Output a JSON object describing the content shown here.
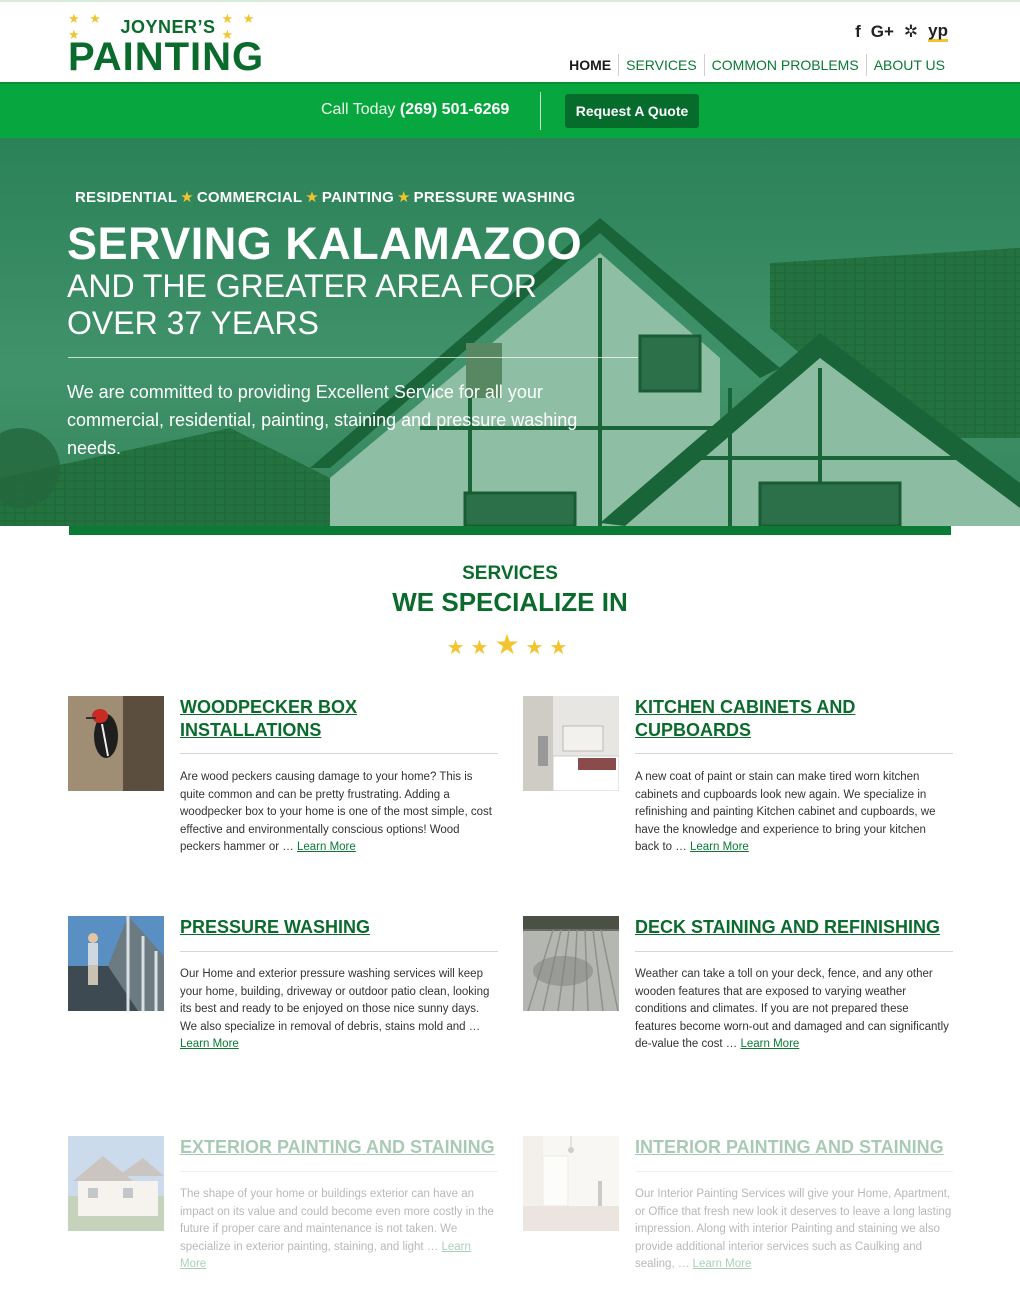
{
  "header": {
    "logo_name": "JOYNER’S",
    "logo_main": "PAINTING",
    "logo_stars": "★ ★ ★",
    "social": [
      {
        "icon": "facebook-icon",
        "label": "f"
      },
      {
        "icon": "google-plus-icon",
        "label": "G+"
      },
      {
        "icon": "yelp-icon",
        "label": "✲"
      },
      {
        "icon": "yellow-pages-icon",
        "label": "yp"
      }
    ],
    "nav": [
      "HOME",
      "SERVICES",
      "COMMON PROBLEMS",
      "ABOUT US"
    ]
  },
  "cta": {
    "call_label": "Call Today",
    "phone": "(269) 501-6269",
    "button": "Request A Quote"
  },
  "hero": {
    "tags": [
      "RESIDENTIAL",
      "COMMERCIAL",
      "PAINTING",
      "PRESSURE WASHING"
    ],
    "title": "SERVING KALAMAZOO",
    "subtitle": "AND THE GREATER AREA FOR OVER 37 YEARS",
    "description": "We are committed to providing Excellent Service for all your commercial, residential, painting, staining and pressure washing needs."
  },
  "services": {
    "kicker": "SERVICES",
    "title": "WE SPECIALIZE IN",
    "learn_more": "Learn More",
    "ellipsis": "…",
    "items": [
      {
        "title": "WOODPECKER BOX INSTALLATIONS",
        "text": "Are wood peckers causing damage to your home? This is quite common and can be pretty frustrating. Adding a woodpecker box to your home is one of the most simple, cost effective and environmentally conscious options! Wood peckers hammer or"
      },
      {
        "title": "KITCHEN CABINETS AND CUPBOARDS",
        "text": "A new coat of paint or stain can make tired worn kitchen cabinets and cupboards look new again. We specialize in refinishing and painting Kitchen cabinet and cupboards, we have the knowledge and experience to bring your kitchen back to"
      },
      {
        "title": "PRESSURE WASHING",
        "text": "Our Home and exterior pressure washing services will keep your home, building, driveway or outdoor patio clean, looking its best and ready to be enjoyed on those nice sunny days. We also specialize in removal of debris, stains mold and"
      },
      {
        "title": "DECK STAINING AND REFINISHING",
        "text": "Weather can take a toll on your deck, fence, and any other wooden features that are exposed to varying weather conditions and climates. If you are not prepared these features become worn-out and damaged and can significantly de-value the cost"
      },
      {
        "title": "EXTERIOR PAINTING AND STAINING",
        "text": "The shape of your home or buildings exterior can have an impact on its value and could become even more costly in the future if proper care and maintenance is not taken. We specialize in exterior painting, staining, and light"
      },
      {
        "title": "INTERIOR PAINTING AND STAINING",
        "text": "Our Interior Painting Services will give your Home, Apartment, or Office that fresh new look it deserves to leave a long lasting impression. Along with interior Painting and staining we also provide additional interior services such as Caulking and sealing,"
      }
    ]
  },
  "colors": {
    "brand_green": "#0a6b2d",
    "bar_green": "#08a63f",
    "star_yellow": "#f2c530"
  }
}
